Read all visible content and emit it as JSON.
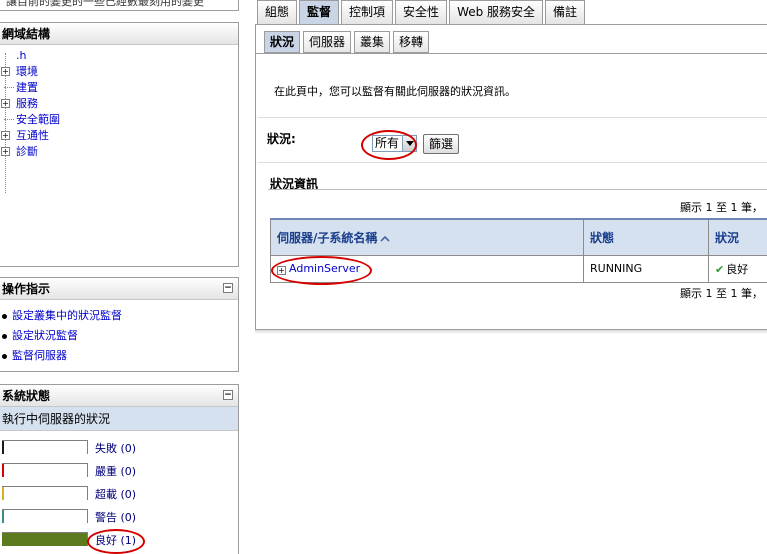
{
  "top_panel": {
    "cut_text": "讓目前的變更的一些已經數最刻用的變更"
  },
  "domain_panel": {
    "title": "網域結構",
    "items": [
      {
        "label": ".h",
        "expandable": false
      },
      {
        "label": "環境",
        "expandable": true
      },
      {
        "label": "建置",
        "expandable": false
      },
      {
        "label": "服務",
        "expandable": true
      },
      {
        "label": "安全範圍",
        "expandable": false
      },
      {
        "label": "互通性",
        "expandable": true
      },
      {
        "label": "診斷",
        "expandable": true
      }
    ]
  },
  "howto_panel": {
    "title": "操作指示",
    "links": [
      "設定叢集中的狀況監督",
      "設定狀況監督",
      "監督伺服器"
    ]
  },
  "status_panel": {
    "title": "系統狀態",
    "subtitle": "執行中伺服器的狀況",
    "rows": [
      {
        "label": "失敗 (0)",
        "color": "#1a1a1a",
        "fill": 0
      },
      {
        "label": "嚴重 (0)",
        "color": "#d80000",
        "fill": 0
      },
      {
        "label": "超載 (0)",
        "color": "#d8b020",
        "fill": 0
      },
      {
        "label": "警告 (0)",
        "color": "#3a8a8a",
        "fill": 0
      },
      {
        "label": "良好 (1)",
        "color": "#5c7a1e",
        "fill": 1
      }
    ]
  },
  "tabs": [
    "組態",
    "監督",
    "控制項",
    "安全性",
    "Web 服務安全",
    "備註"
  ],
  "subtabs": [
    "狀況",
    "伺服器",
    "叢集",
    "移轉"
  ],
  "intro": "在此頁中，您可以監督有關此伺服器的狀況資訊。",
  "filter": {
    "label": "狀況:",
    "selected": "所有",
    "button": "篩選"
  },
  "section": {
    "title": "狀況資訊",
    "paging_top": "顯示 1 至 1 筆，",
    "paging_bottom": "顯示 1 至 1 筆，"
  },
  "table": {
    "headers": [
      "伺服器/子系統名稱",
      "狀態",
      "狀況"
    ],
    "rows": [
      {
        "name": "AdminServer",
        "state": "RUNNING",
        "health": "良好"
      }
    ]
  },
  "colors": {
    "accent": "#c9d5e6",
    "annotation": "#d40000"
  }
}
